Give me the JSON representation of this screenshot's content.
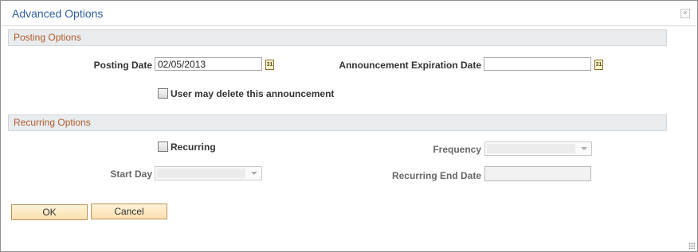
{
  "dialog": {
    "title": "Advanced Options",
    "close_label": "×"
  },
  "posting": {
    "section_title": "Posting Options",
    "posting_date_label": "Posting Date",
    "posting_date_value": "02/05/2013",
    "announcement_expiration_label": "Announcement Expiration Date",
    "announcement_expiration_value": "",
    "user_may_delete_label": "User may delete this announcement",
    "calendar_glyph": "31"
  },
  "recurring": {
    "section_title": "Recurring Options",
    "recurring_label": "Recurring",
    "frequency_label": "Frequency",
    "start_day_label": "Start Day",
    "recurring_end_date_label": "Recurring End Date"
  },
  "buttons": {
    "ok_label": "OK",
    "cancel_label": "Cancel"
  },
  "colors": {
    "title": "#2d5f99",
    "section_title": "#b35a2b",
    "section_bg": "#e8ecef",
    "button_bg": "#fbdfae"
  }
}
